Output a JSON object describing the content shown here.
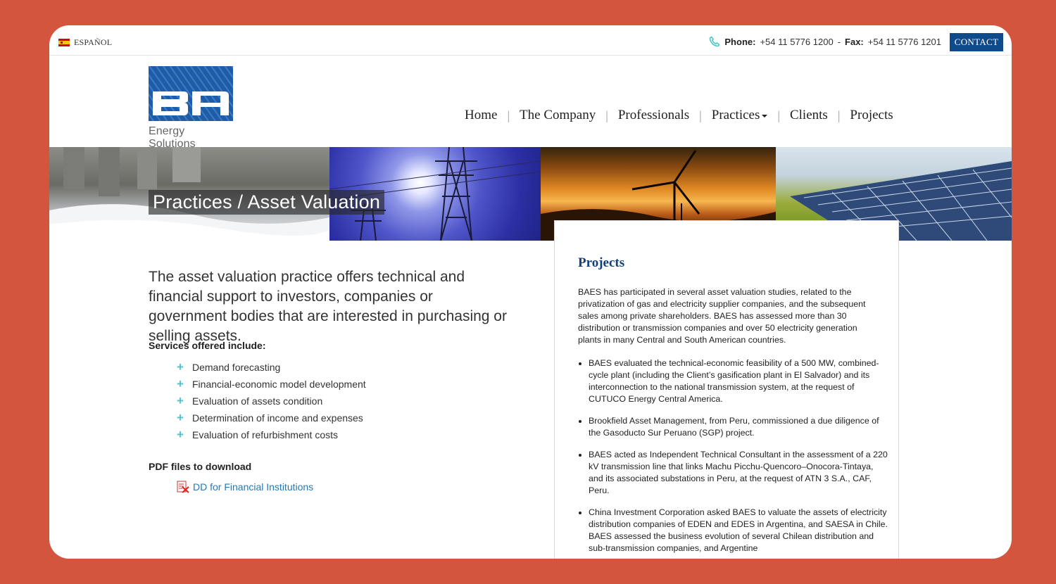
{
  "topbar": {
    "language": "ESPAÑOL",
    "phone_label": "Phone:",
    "phone": "+54 11 5776 1200",
    "fax_sep": "-",
    "fax_label": "Fax:",
    "fax": "+54 11 5776 1201",
    "contact_button": "CONTACT"
  },
  "logo": {
    "tagline": "Energy Solutions"
  },
  "nav": {
    "items": [
      "Home",
      "The Company",
      "Professionals",
      "Practices",
      "Clients",
      "Projects"
    ]
  },
  "banner": {
    "title": "Practices / Asset Valuation"
  },
  "main": {
    "intro": "The asset valuation practice offers technical and financial support to investors, companies or government bodies that are interested in purchasing or selling assets.",
    "services_heading": "Services offered include:",
    "services": [
      "Demand forecasting",
      "Financial-economic model development",
      "Evaluation of assets condition",
      "Determination of income and expenses",
      "Evaluation of refurbishment costs"
    ],
    "pdf_heading": "PDF files to download",
    "pdf_link": "DD for Financial Institutions"
  },
  "projects": {
    "title": "Projects",
    "intro": "BAES has participated in several asset valuation studies, related to the privatization of gas and electricity supplier companies, and the subsequent sales among private shareholders. BAES has assessed more than 30 distribution or transmission companies and over 50 electricity generation plants in many Central and South American countries.",
    "items": [
      "BAES evaluated the technical-economic feasibility of a 500 MW, combined-cycle plant (including the Client’s gasification plant in El Salvador) and its interconnection to the national transmission system, at the request of CUTUCO Energy Central America.",
      "Brookfield Asset Management, from Peru, commissioned a due diligence of the Gasoducto Sur Peruano (SGP) project.",
      "BAES acted as Independent Technical Consultant in the assessment of a 220 kV transmission line that links Machu Picchu-Quencoro–Onocora-Tintaya, and its associated substations in Peru, at the request of ATN 3 S.A., CAF, Peru.",
      "China Investment Corporation asked BAES to valuate the assets of electricity distribution companies of EDEN and EDES in Argentina, and SAESA in Chile. BAES assessed the business evolution of several Chilean distribution and sub-transmission companies, and Argentine"
    ]
  },
  "colors": {
    "background": "#d4553e",
    "brand_blue": "#0f4a8a",
    "heading_blue": "#123f7a",
    "link": "#1f7ab8",
    "accent_teal": "#4fc3c9"
  }
}
